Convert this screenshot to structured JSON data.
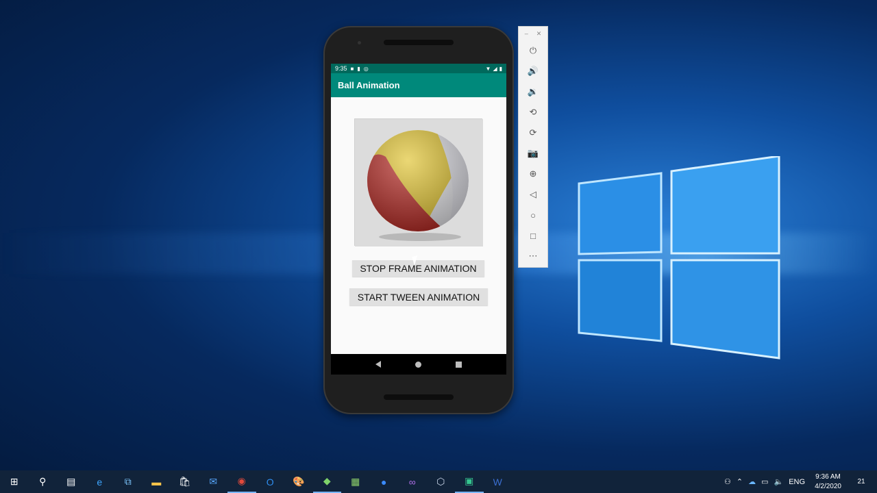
{
  "phone": {
    "status_time": "9:35",
    "app_title": "Ball Animation",
    "buttons": {
      "stop_frame": "STOP FRAME ANIMATION",
      "start_tween": "START TWEEN ANIMATION"
    }
  },
  "emulator_toolbar": {
    "items": [
      "power-icon",
      "volume-up-icon",
      "volume-down-icon",
      "rotate-left-icon",
      "rotate-right-icon",
      "camera-icon",
      "zoom-icon",
      "back-icon",
      "home-icon",
      "overview-icon",
      "more-icon"
    ]
  },
  "taskbar": {
    "language": "ENG",
    "time": "9:36 AM",
    "date": "4/2/2020",
    "notification_count": "21",
    "pinned_apps": [
      "start",
      "search",
      "task-view",
      "edge",
      "network",
      "file-explorer",
      "store",
      "mail",
      "chrome",
      "outlook",
      "paint",
      "android-studio",
      "notepad",
      "zoom",
      "visual-studio",
      "virtualbox",
      "terminal",
      "word"
    ]
  },
  "colors": {
    "app_bar": "#00897b",
    "status_bar": "#00695c",
    "button_bg": "#e0e0e0",
    "taskbar_bg": "#11233a",
    "desktop_blue": "#0f4e9e"
  }
}
